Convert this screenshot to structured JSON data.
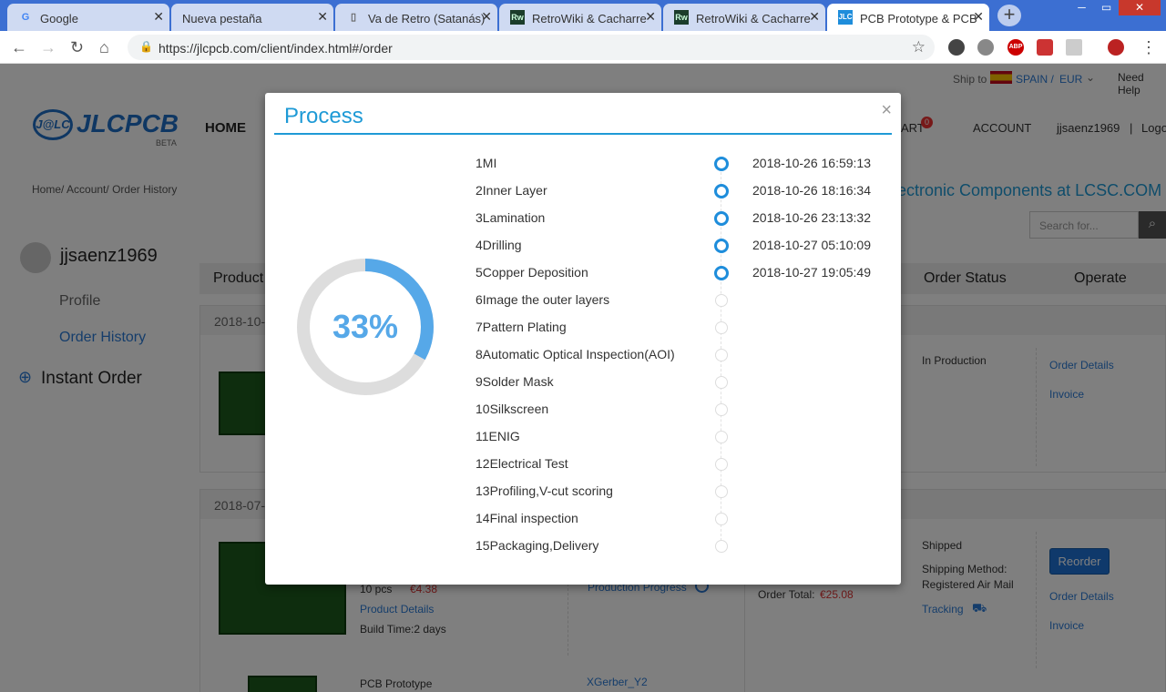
{
  "browser": {
    "tabs": [
      {
        "title": "Google",
        "icon": "google-favicon"
      },
      {
        "title": "Nueva pestaña",
        "icon": "blank-favicon"
      },
      {
        "title": "Va de Retro (Satanás)",
        "icon": "page-favicon"
      },
      {
        "title": "RetroWiki & Cacharre",
        "icon": "rw-favicon"
      },
      {
        "title": "RetroWiki & Cacharre",
        "icon": "rw-favicon"
      },
      {
        "title": "PCB Prototype & PCB",
        "icon": "jlc-favicon"
      }
    ],
    "url": "https://jlcpcb.com/client/index.html#/order"
  },
  "site": {
    "logo": "JLCPCB",
    "logo_badge": "BETA",
    "nav_home": "HOME",
    "cart_label": "ART",
    "cart_count": "0",
    "account": "ACCOUNT",
    "username": "jjsaenz1969",
    "separator": "|",
    "logout": "Logo",
    "ship_to": "Ship to",
    "country": "SPAIN /",
    "currency": "EUR",
    "need_help": "Need Help",
    "breadcrumb": [
      "Home/",
      "Account/",
      "Order History"
    ],
    "lcsc_banner": "ectronic Components at LCSC.COM",
    "search_placeholder": "Search for...",
    "sidebar": {
      "username": "jjsaenz1969",
      "profile": "Profile",
      "order_history": "Order History",
      "instant_order": "Instant Order"
    },
    "table_headers": {
      "product": "Product",
      "order_status": "Order Status",
      "operate": "Operate"
    },
    "orders": [
      {
        "date": "2018-10-",
        "status": "In Production",
        "actions": [
          "Order Details",
          "Invoice"
        ]
      },
      {
        "date": "2018-07-",
        "qty": "10 pcs",
        "price": "€4.38",
        "product_details": "Product Details",
        "build_time": "Build Time:2 days",
        "production_progress": "Production Progress",
        "order_total_label": "Order Total:",
        "order_total": "€25.08",
        "status": "Shipped",
        "shipping_method_label": "Shipping Method:",
        "shipping_method": "Registered Air Mail",
        "tracking": "Tracking",
        "reorder": "Reorder",
        "actions": [
          "Order Details",
          "Invoice"
        ]
      }
    ],
    "third_row": {
      "product": "PCB Prototype",
      "gerber": "XGerber_Y2"
    }
  },
  "modal": {
    "title": "Process",
    "close": "×",
    "progress": 0.33,
    "progress_label": "33%",
    "colors": {
      "accent": "#1e9ad6",
      "ring_fill": "#56a8e8",
      "ring_track": "#dddddd"
    },
    "steps": [
      {
        "label": "1MI",
        "time": "2018-10-26 16:59:13",
        "done": true
      },
      {
        "label": "2Inner Layer",
        "time": "2018-10-26 18:16:34",
        "done": true
      },
      {
        "label": "3Lamination",
        "time": "2018-10-26 23:13:32",
        "done": true
      },
      {
        "label": "4Drilling",
        "time": "2018-10-27 05:10:09",
        "done": true
      },
      {
        "label": "5Copper Deposition",
        "time": "2018-10-27 19:05:49",
        "done": true
      },
      {
        "label": "6Image the outer layers",
        "time": "",
        "done": false
      },
      {
        "label": "7Pattern Plating",
        "time": "",
        "done": false
      },
      {
        "label": "8Automatic Optical Inspection(AOI)",
        "time": "",
        "done": false
      },
      {
        "label": "9Solder Mask",
        "time": "",
        "done": false
      },
      {
        "label": "10Silkscreen",
        "time": "",
        "done": false
      },
      {
        "label": "11ENIG",
        "time": "",
        "done": false
      },
      {
        "label": "12Electrical Test",
        "time": "",
        "done": false
      },
      {
        "label": "13Profiling,V-cut scoring",
        "time": "",
        "done": false
      },
      {
        "label": "14Final inspection",
        "time": "",
        "done": false
      },
      {
        "label": "15Packaging,Delivery",
        "time": "",
        "done": false
      }
    ]
  }
}
